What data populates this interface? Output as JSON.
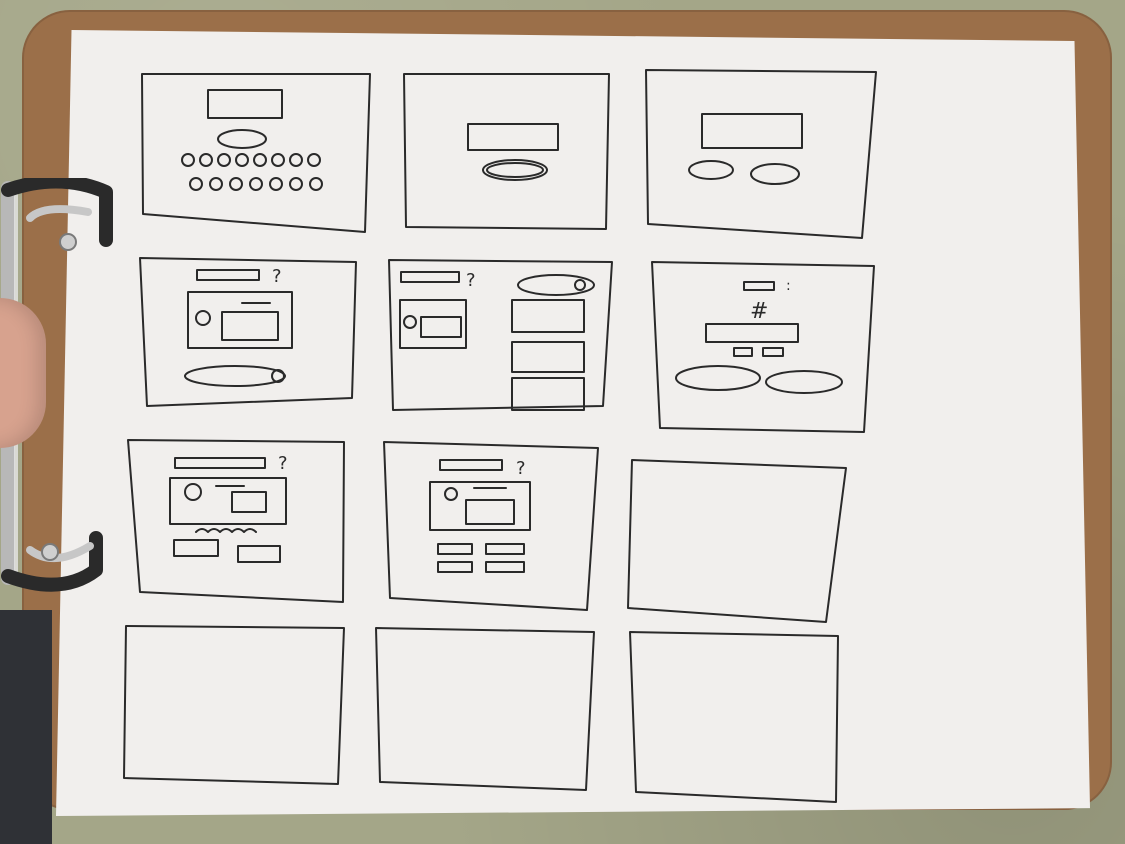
{
  "photo": {
    "subject": "",
    "panels": [
      {
        "id": 1,
        "question_mark": ""
      },
      {
        "id": 2,
        "question_mark": ""
      },
      {
        "id": 3,
        "question_mark": ""
      },
      {
        "id": 4,
        "question_mark": "?"
      },
      {
        "id": 5,
        "question_mark": "?"
      },
      {
        "id": 6,
        "hash_mark": "#",
        "colon": ":"
      },
      {
        "id": 7,
        "question_mark": "?"
      },
      {
        "id": 8,
        "question_mark": "?"
      },
      {
        "id": 9,
        "question_mark": ""
      },
      {
        "id": 10,
        "question_mark": ""
      },
      {
        "id": 11,
        "question_mark": ""
      },
      {
        "id": 12,
        "question_mark": ""
      }
    ]
  },
  "colors": {
    "paper": "#f1efed",
    "ink": "#2a2a2a",
    "clipboard": "#9b6f49",
    "wall": "#a4a688",
    "metal": "#b8b8b8"
  }
}
